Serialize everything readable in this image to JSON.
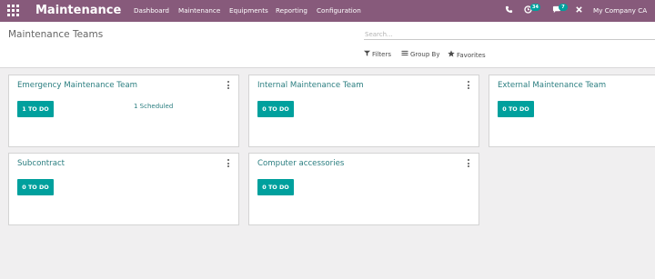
{
  "navbar": {
    "app_name": "Maintenance",
    "menu": [
      "Dashboard",
      "Maintenance",
      "Equipments",
      "Reporting",
      "Configuration"
    ],
    "phone_icon": "phone-icon",
    "activity_icon": "clock-icon",
    "activity_count": "34",
    "messages_icon": "chat-icon",
    "messages_count": "7",
    "debug_icon": "tools-icon",
    "company": "My Company CA",
    "color": "#875a7b",
    "badge_color": "#00a09d"
  },
  "control_panel": {
    "title": "Maintenance Teams",
    "search_placeholder": "Search...",
    "filters_label": "Filters",
    "group_by_label": "Group By",
    "favorites_label": "Favorites"
  },
  "teams": [
    {
      "name": "Emergency Maintenance Team",
      "todo": "1 TO DO",
      "scheduled": "1 Scheduled"
    },
    {
      "name": "Internal Maintenance Team",
      "todo": "0 TO DO"
    },
    {
      "name": "External Maintenance Team",
      "todo": "0 TO DO"
    },
    {
      "name": "Subcontract",
      "todo": "0 TO DO"
    },
    {
      "name": "Computer accessories",
      "todo": "0 TO DO"
    }
  ],
  "accent_color": "#00a09d",
  "title_color": "#2b7e80"
}
